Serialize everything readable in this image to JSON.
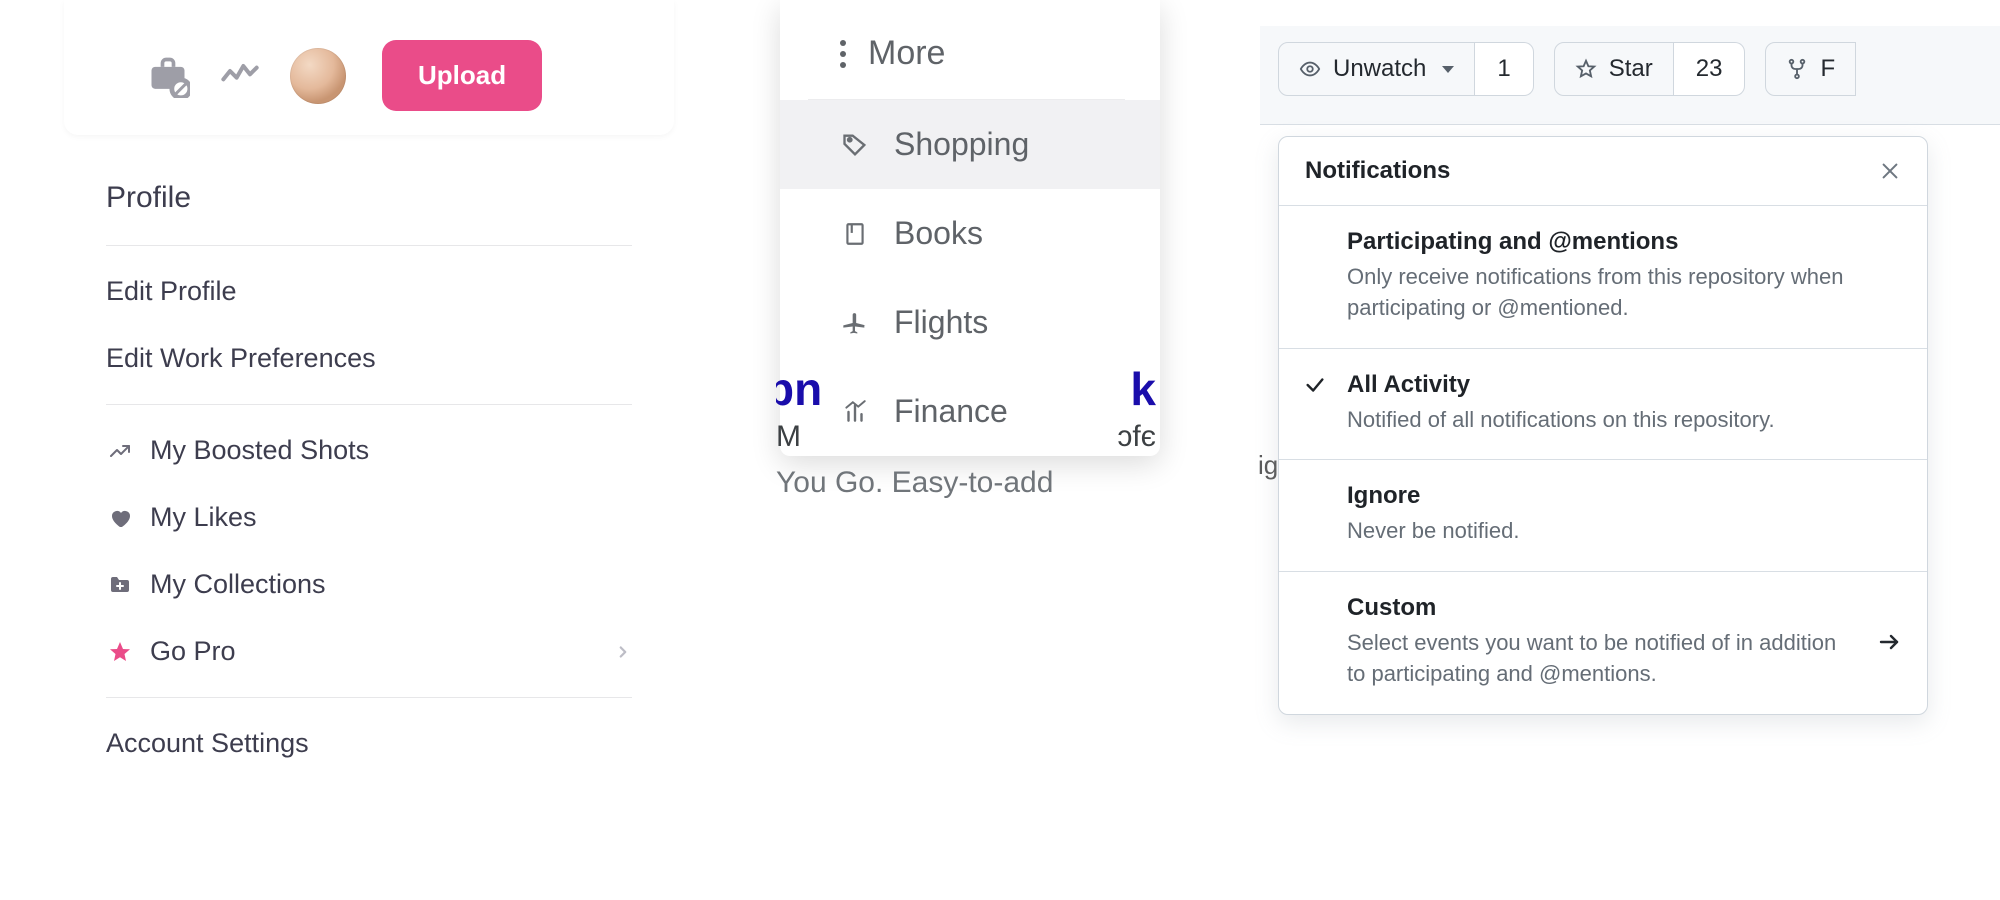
{
  "panelA": {
    "upload_label": "Upload",
    "menu": {
      "profile": "Profile",
      "edit_profile": "Edit Profile",
      "edit_work_prefs": "Edit Work Preferences",
      "boosted": "My Boosted Shots",
      "likes": "My Likes",
      "collections": "My Collections",
      "go_pro": "Go Pro",
      "account_settings": "Account Settings"
    }
  },
  "panelB": {
    "more_label": "More",
    "items": {
      "shopping": "Shopping",
      "books": "Books",
      "flights": "Flights",
      "finance": "Finance"
    },
    "bg": {
      "line2_left": "M",
      "line2_right": "ɔfє",
      "line3": "You Go. Easy-to-add"
    }
  },
  "panelC": {
    "buttons": {
      "unwatch": "Unwatch",
      "unwatch_count": "1",
      "star": "Star",
      "star_count": "23",
      "fork_initial": "F"
    },
    "popover": {
      "title": "Notifications",
      "opts": [
        {
          "title": "Participating and @mentions",
          "desc": "Only receive notifications from this repository when participating or @mentioned.",
          "checked": false,
          "arrow": false
        },
        {
          "title": "All Activity",
          "desc": "Notified of all notifications on this repository.",
          "checked": true,
          "arrow": false
        },
        {
          "title": "Ignore",
          "desc": "Never be notified.",
          "checked": false,
          "arrow": false
        },
        {
          "title": "Custom",
          "desc": "Select events you want to be notified of in addition to participating and @mentions.",
          "checked": false,
          "arrow": true
        }
      ]
    },
    "behind_text": "ig"
  }
}
